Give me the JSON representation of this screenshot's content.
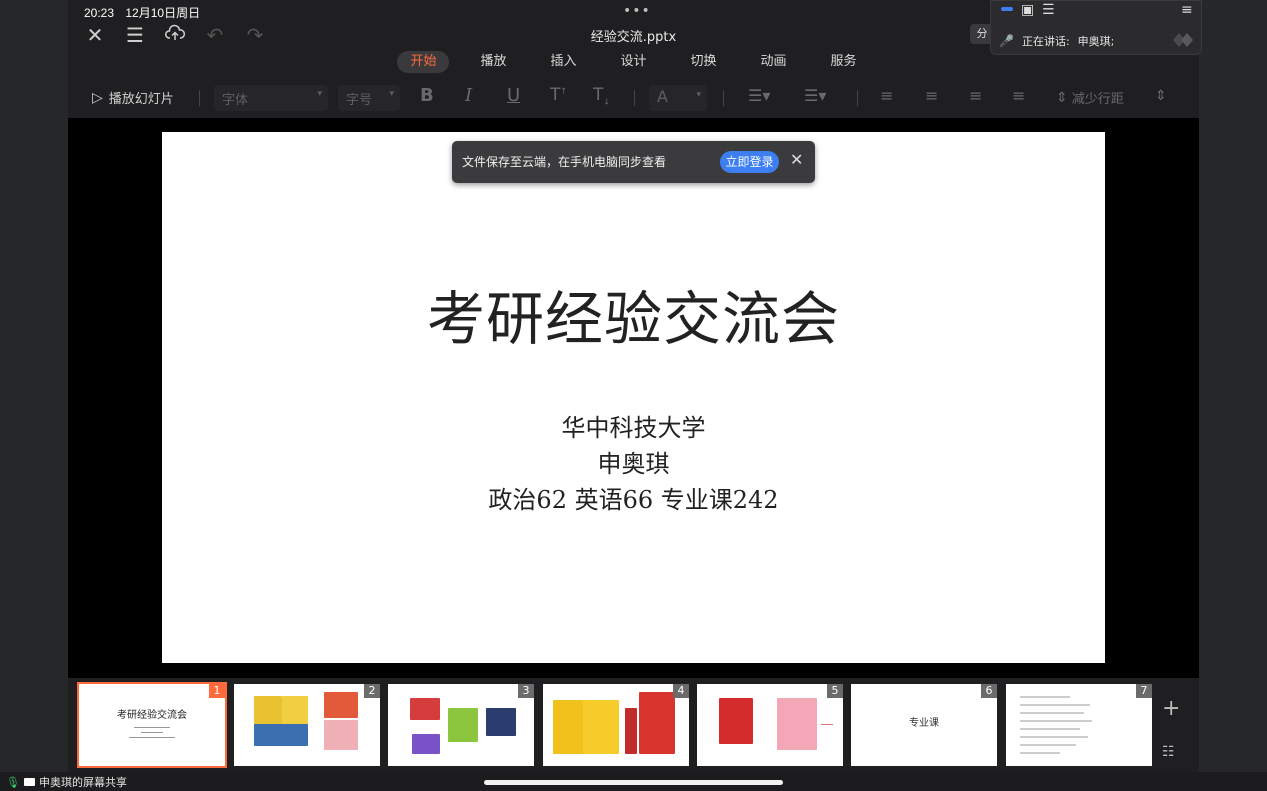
{
  "status": {
    "time": "20:23",
    "date": "12月10日周日"
  },
  "app": {
    "doc_title": "经验交流.pptx",
    "share_label": "分",
    "tabs": [
      "开始",
      "播放",
      "插入",
      "设计",
      "切换",
      "动画",
      "服务"
    ],
    "active_tab": "开始",
    "toolbar": {
      "play_label": "播放幻灯片",
      "font_placeholder": "字体",
      "size_placeholder": "字号",
      "bold": "B",
      "italic": "I",
      "underline": "U",
      "font_color": "A",
      "line_spacing_label": "减少行距"
    }
  },
  "toast": {
    "message": "文件保存至云端，在手机电脑同步查看",
    "login_button": "立即登录",
    "close": "✕"
  },
  "slide": {
    "title": "考研经验交流会",
    "university": "华中科技大学",
    "name": "申奥琪",
    "scores": "政治62  英语66  专业课242"
  },
  "thumbnails": [
    {
      "num": "1",
      "title": "考研经验交流会",
      "active": true
    },
    {
      "num": "2",
      "title": ""
    },
    {
      "num": "3",
      "title": ""
    },
    {
      "num": "4",
      "title": ""
    },
    {
      "num": "5",
      "title": ""
    },
    {
      "num": "6",
      "title": "专业课"
    },
    {
      "num": "7",
      "title": ""
    }
  ],
  "strip_controls": {
    "add": "+",
    "grid": "☷"
  },
  "meeting_panel": {
    "speaking_label": "正在讲话:",
    "speaker": "申奥琪;"
  },
  "bottom": {
    "share_label": "申奥琪的屏幕共享"
  },
  "colors": {
    "accent": "#ff6a3d",
    "primary_blue": "#3d7ff0"
  }
}
